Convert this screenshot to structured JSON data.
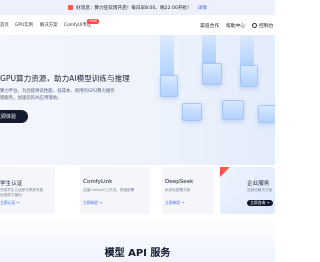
{
  "banner": {
    "text": "好消息：算力狂欢周开启！每日早8:00、晚22:00开抢！",
    "action": "详情"
  },
  "nav": {
    "items": [
      {
        "label": "首页"
      },
      {
        "label": "GPU实例"
      },
      {
        "label": "解决方案"
      },
      {
        "label": "ComfyUI专区",
        "badge": "NEW"
      }
    ],
    "right": {
      "enterprise": "渠道合作",
      "help": "帮助中心",
      "console": "控制台"
    }
  },
  "hero": {
    "headline": "GPU算力资源，助力AI模型训练与推理",
    "sub1": "算力平台，为您提供高性能、低成本、易用的GPU算力服务",
    "sub2": "理服务，加速您的AI应用落地。",
    "cta": "立即体验"
  },
  "cards": [
    {
      "title": "学生认证",
      "desc1": "完成学生认证即可享受专属",
      "desc2": "优惠算力福利",
      "link": "立即认证 →"
    },
    {
      "title": "ComfyLink",
      "desc1": "连接ComfyUI工作流，快速部署",
      "desc2": "",
      "link": "立即体验 →"
    },
    {
      "title": "DeepSeek",
      "desc1": "私有化部署方案",
      "desc2": "",
      "link": "立即体验 →"
    },
    {
      "title": "企业服务",
      "desc1": "定制化解决方案",
      "desc2": "",
      "link": "立即咨询 →"
    }
  ],
  "section": {
    "title": "模型 API 服务"
  },
  "colors": {
    "accent": "#3b66f5",
    "dark": "#141a2e",
    "hot": "#ff4d4f"
  }
}
